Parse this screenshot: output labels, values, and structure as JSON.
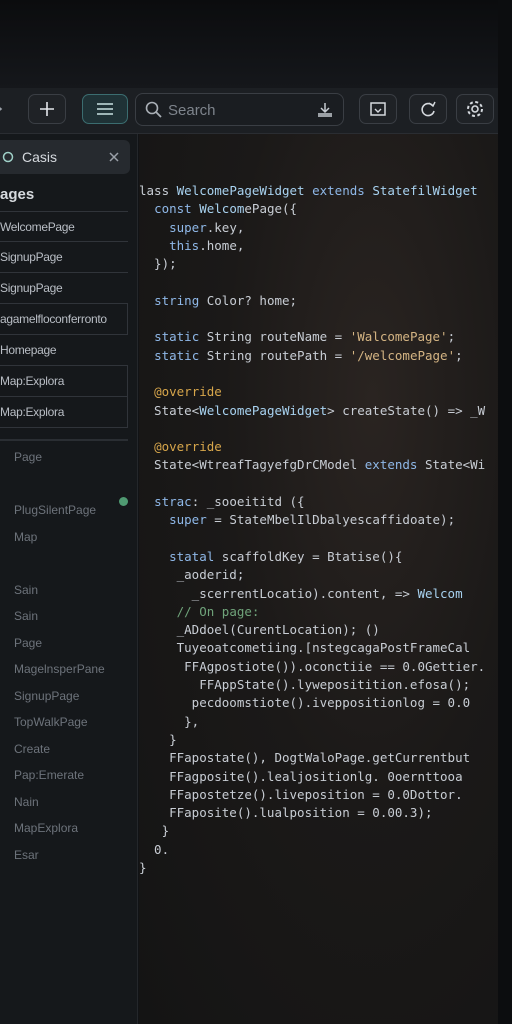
{
  "toolbar": {
    "add_icon": "plus-icon",
    "menu_icon": "hamburger-icon",
    "search_placeholder": "Search",
    "search_action_icon": "tray-download-icon",
    "preview_icon": "window-icon",
    "refresh_icon": "refresh-icon",
    "settings_icon": "gear-icon"
  },
  "sidebar": {
    "search_value": "Casis",
    "section_title": "ages",
    "items": [
      "WelcomePage",
      "SignupPage",
      "SignupPage",
      "agamelfloconferronto",
      "Homepage",
      "Map:Explora",
      "Map:Explora"
    ],
    "dim_items": [
      "Page",
      "",
      "PlugSilentPage",
      "Map",
      "",
      "Sain",
      "Sain",
      "Page",
      "MagelnsperPane",
      "SignupPage",
      "TopWalkPage",
      "Create",
      "Pap:Emerate",
      "Nain",
      "MapExplora",
      "Esar"
    ]
  },
  "code": [
    "lass WelcomePageWidget extends StatefilWidget",
    "  const WelcomePage({",
    "    super.key,",
    "    this.home,",
    "  });",
    "",
    "  string Color? home;",
    "",
    "  static String routeName = 'WalcomePage';",
    "  static String routePath = '/welcomePage';",
    "",
    "  @override",
    "  State<WelcomePageWidget> createState() => _W",
    "",
    "  @override",
    "  State<WtreafTagyefgDrCModel extends State<Wi",
    "",
    "  strac: _sooeititd ({",
    "    super = StateMbelIlDbalyescaffidoate);",
    "",
    "    statal scaffoldKey = Btatise(){",
    "     _aoderid;",
    "       _scerrentLocatio).content, => Welcom",
    "     // On page:",
    "     _ADdoel(CurentLocation); ()",
    "     Tuyeoatcometiing.[nstegcagaPostFrameCal",
    "      FFAgpostiote()).oconctiie == 0.0Gettier.",
    "        FFAppState().lywepositition.efosa();",
    "       pecdoomstiote().iveppositionlog = 0.0",
    "      },",
    "    }",
    "    FFapostate(), DogtWaloPage.getCurrentbut",
    "    FFagposite().lealjositionlg. 0oernttooa",
    "    FFapostetze().liveposition = 0.0Dottor.",
    "    FFaposite().lualposition = 0.00.3);",
    "   }",
    "  0.",
    "}"
  ]
}
